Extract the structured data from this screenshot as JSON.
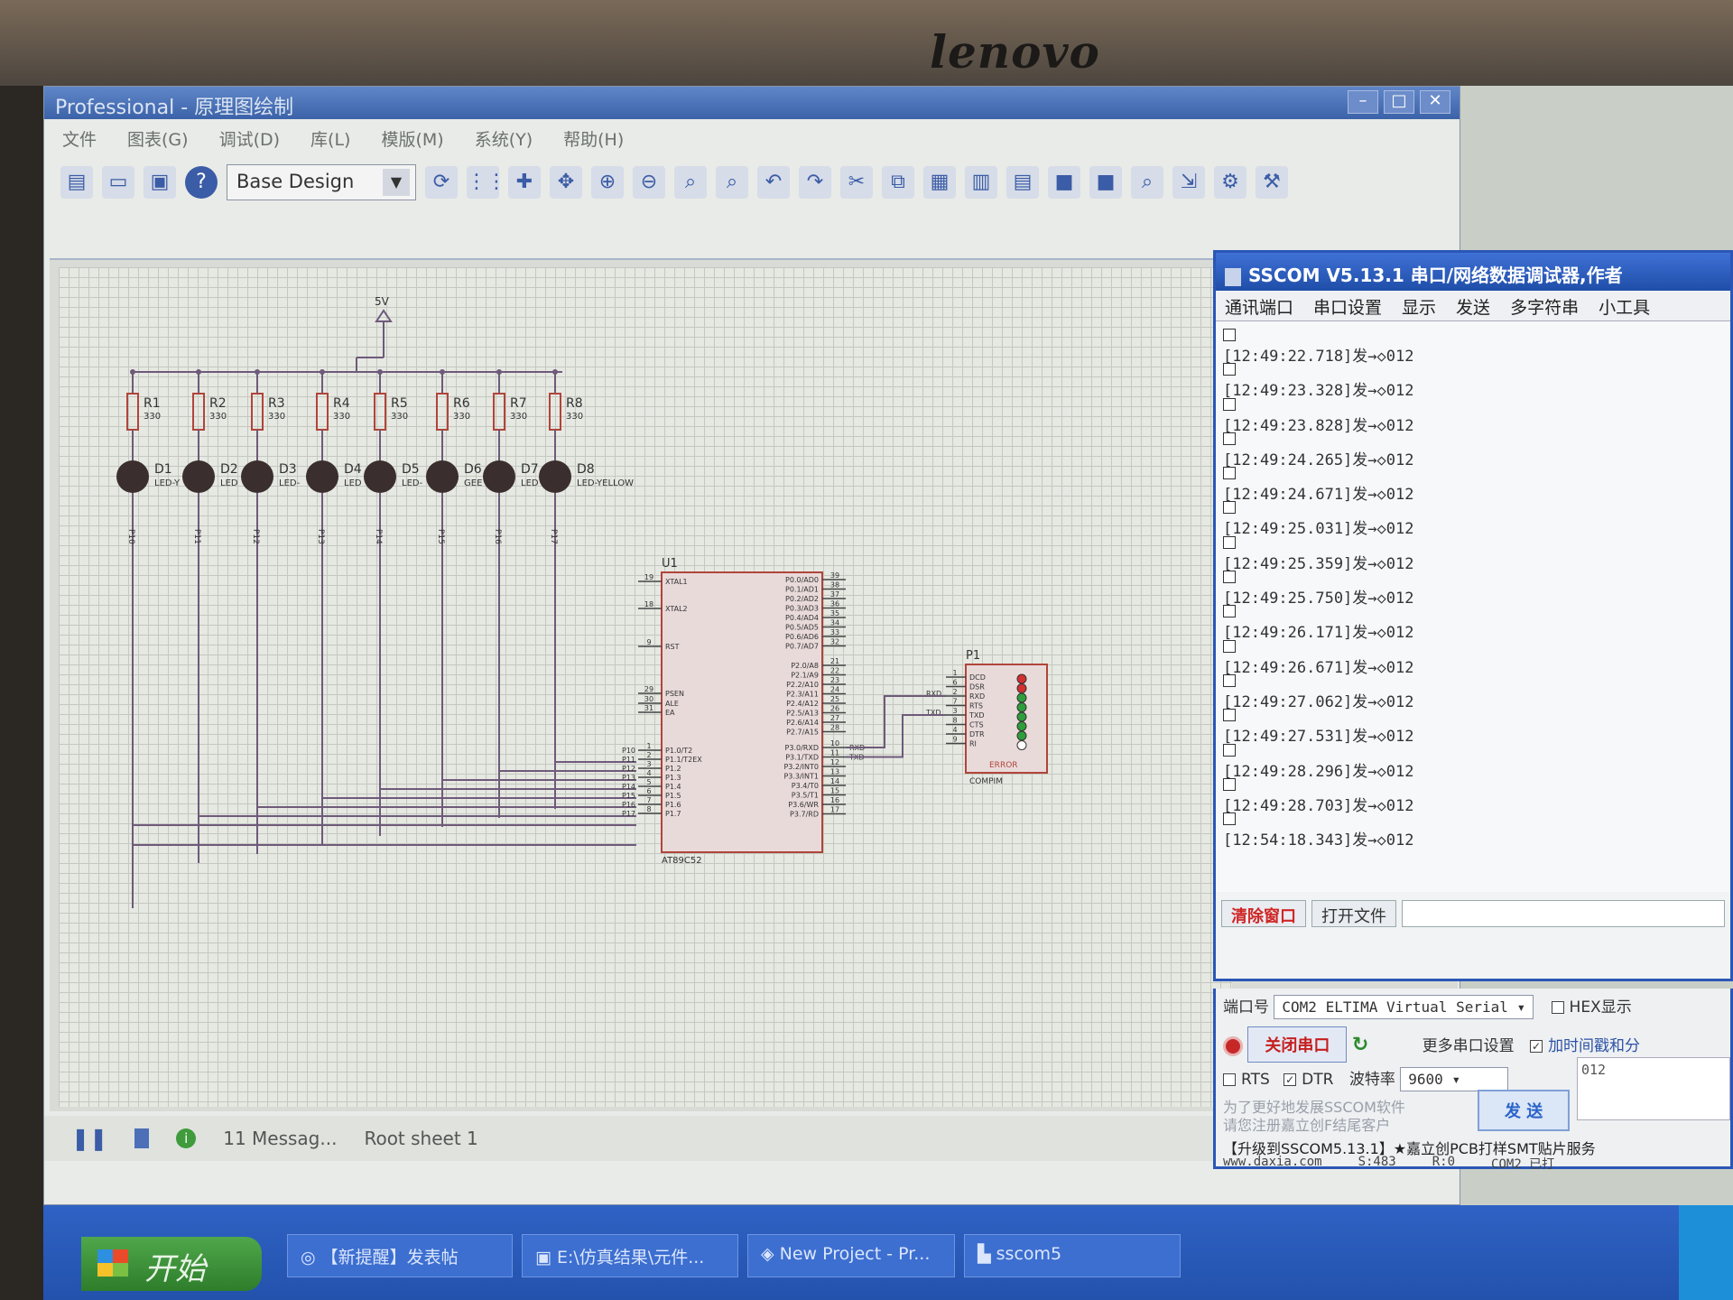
{
  "monitor": {
    "brand": "lenovo"
  },
  "proteus": {
    "title": "Professional - 原理图绘制",
    "menu": [
      "文件",
      "图表(G)",
      "调试(D)",
      "库(L)",
      "模版(M)",
      "系统(Y)",
      "帮助(H)"
    ],
    "design_select": "Base Design",
    "status": {
      "messages": "11 Messag...",
      "sheet": "Root sheet 1"
    },
    "schematic": {
      "power_label": "5V",
      "resistors": [
        {
          "ref": "R1",
          "val": "330"
        },
        {
          "ref": "R2",
          "val": "330"
        },
        {
          "ref": "R3",
          "val": "330"
        },
        {
          "ref": "R4",
          "val": "330"
        },
        {
          "ref": "R5",
          "val": "330"
        },
        {
          "ref": "R6",
          "val": "330"
        },
        {
          "ref": "R7",
          "val": "330"
        },
        {
          "ref": "R8",
          "val": "330"
        }
      ],
      "leds": [
        {
          "ref": "D1",
          "type": "LED-Y"
        },
        {
          "ref": "D2",
          "type": "LED"
        },
        {
          "ref": "D3",
          "type": "LED-"
        },
        {
          "ref": "D4",
          "type": "LED"
        },
        {
          "ref": "D5",
          "type": "LED-"
        },
        {
          "ref": "D6",
          "type": "GEE"
        },
        {
          "ref": "D7",
          "type": "LED"
        },
        {
          "ref": "D8",
          "type": "LED-YELLOW"
        }
      ],
      "led_nets": [
        "P10",
        "P11",
        "P12",
        "P13",
        "P14",
        "P15",
        "P16",
        "P17"
      ],
      "mcu": {
        "ref": "U1",
        "part": "AT89C52",
        "left_pins": [
          {
            "num": "19",
            "name": "XTAL1"
          },
          {
            "num": "18",
            "name": "XTAL2"
          },
          {
            "num": "9",
            "name": "RST"
          },
          {
            "num": "29",
            "name": "PSEN"
          },
          {
            "num": "30",
            "name": "ALE"
          },
          {
            "num": "31",
            "name": "EA"
          },
          {
            "num": "1",
            "name": "P1.0/T2"
          },
          {
            "num": "2",
            "name": "P1.1/T2EX"
          },
          {
            "num": "3",
            "name": "P1.2"
          },
          {
            "num": "4",
            "name": "P1.3"
          },
          {
            "num": "5",
            "name": "P1.4"
          },
          {
            "num": "6",
            "name": "P1.5"
          },
          {
            "num": "7",
            "name": "P1.6"
          },
          {
            "num": "8",
            "name": "P1.7"
          }
        ],
        "right_pins": [
          {
            "num": "39",
            "name": "P0.0/AD0"
          },
          {
            "num": "38",
            "name": "P0.1/AD1"
          },
          {
            "num": "37",
            "name": "P0.2/AD2"
          },
          {
            "num": "36",
            "name": "P0.3/AD3"
          },
          {
            "num": "35",
            "name": "P0.4/AD4"
          },
          {
            "num": "34",
            "name": "P0.5/AD5"
          },
          {
            "num": "33",
            "name": "P0.6/AD6"
          },
          {
            "num": "32",
            "name": "P0.7/AD7"
          },
          {
            "num": "21",
            "name": "P2.0/A8"
          },
          {
            "num": "22",
            "name": "P2.1/A9"
          },
          {
            "num": "23",
            "name": "P2.2/A10"
          },
          {
            "num": "24",
            "name": "P2.3/A11"
          },
          {
            "num": "25",
            "name": "P2.4/A12"
          },
          {
            "num": "26",
            "name": "P2.5/A13"
          },
          {
            "num": "27",
            "name": "P2.6/A14"
          },
          {
            "num": "28",
            "name": "P2.7/A15"
          },
          {
            "num": "10",
            "name": "P3.0/RXD"
          },
          {
            "num": "11",
            "name": "P3.1/TXD"
          },
          {
            "num": "12",
            "name": "P3.2/INT0"
          },
          {
            "num": "13",
            "name": "P3.3/INT1"
          },
          {
            "num": "14",
            "name": "P3.4/T0"
          },
          {
            "num": "15",
            "name": "P3.5/T1"
          },
          {
            "num": "16",
            "name": "P3.6/WR"
          },
          {
            "num": "17",
            "name": "P3.7/RD"
          }
        ]
      },
      "com": {
        "ref": "P1",
        "part": "COMPIM",
        "pins": [
          {
            "num": "1",
            "name": "DCD"
          },
          {
            "num": "6",
            "name": "DSR"
          },
          {
            "num": "2",
            "name": "RXD"
          },
          {
            "num": "7",
            "name": "RTS"
          },
          {
            "num": "3",
            "name": "TXD"
          },
          {
            "num": "8",
            "name": "CTS"
          },
          {
            "num": "4",
            "name": "DTR"
          },
          {
            "num": "9",
            "name": "RI"
          }
        ],
        "error_label": "ERROR",
        "net_rxd": "RXD",
        "net_txd": "TXD"
      }
    }
  },
  "sscom": {
    "title": "SSCOM V5.13.1 串口/网络数据调试器,作者",
    "tabs": [
      "通讯端口",
      "串口设置",
      "显示",
      "发送",
      "多字符串",
      "小工具"
    ],
    "log": [
      "[12:49:22.718]发→◇012",
      "[12:49:23.328]发→◇012",
      "[12:49:23.828]发→◇012",
      "[12:49:24.265]发→◇012",
      "[12:49:24.671]发→◇012",
      "[12:49:25.031]发→◇012",
      "[12:49:25.359]发→◇012",
      "[12:49:25.750]发→◇012",
      "[12:49:26.171]发→◇012",
      "[12:49:26.671]发→◇012",
      "[12:49:27.062]发→◇012",
      "[12:49:27.531]发→◇012",
      "[12:49:28.296]发→◇012",
      "[12:49:28.703]发→◇012",
      "[12:54:18.343]发→◇012"
    ],
    "clear_label": "清除窗口",
    "open_file_label": "打开文件",
    "port_label": "端口号",
    "port_value": "COM2 ELTIMA Virtual Serial",
    "hex_label": "HEX显示",
    "close_port_label": "关闭串口",
    "more_settings_label": "更多串口设置",
    "timestamp_label": "加时间戳和分",
    "rts_label": "RTS",
    "dtr_label": "DTR",
    "baud_label": "波特率",
    "baud_value": "9600",
    "send_text": "012",
    "send_label": "发 送",
    "promo_1": "为了更好地发展SSCOM软件",
    "promo_2": "请您注册嘉立创F结尾客户",
    "upgrade_text": "【升级到SSCOM5.13.1】★嘉立创PCB打样SMT贴片服务",
    "website": "www.daxia.com",
    "s_count": "S:483",
    "r_count": "R:0",
    "port_status": "COM2 已打"
  },
  "taskbar": {
    "start": "开始",
    "tasks": [
      "【新提醒】发表帖",
      "E:\\仿真结果\\元件...",
      "New Project - Pr...",
      "sscom5"
    ]
  }
}
